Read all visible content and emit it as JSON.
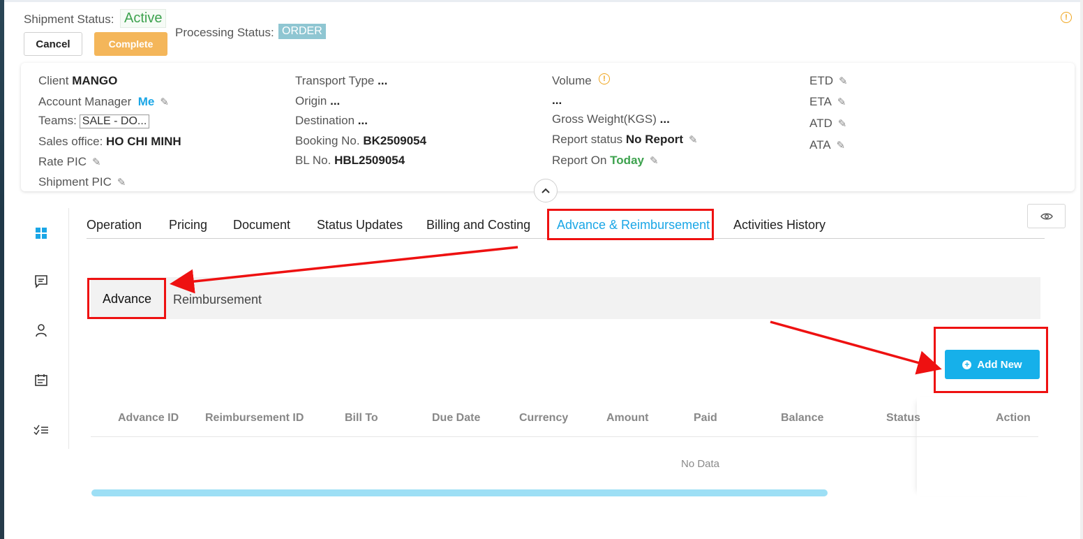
{
  "header": {
    "shipment_status_label": "Shipment Status:",
    "shipment_status_value": "Active",
    "processing_status_label": "Processing Status:",
    "processing_status_value": "ORDER",
    "cancel_label": "Cancel",
    "complete_label": "Complete"
  },
  "info": {
    "client_label": "Client",
    "client_value": "MANGO",
    "account_manager_label": "Account Manager",
    "account_manager_value": "Me",
    "teams_label": "Teams:",
    "teams_value": "SALE - DO...",
    "sales_office_label": "Sales office:",
    "sales_office_value": "HO CHI MINH",
    "rate_pic_label": "Rate PIC",
    "shipment_pic_label": "Shipment PIC",
    "transport_type_label": "Transport Type",
    "transport_type_value": "...",
    "origin_label": "Origin",
    "origin_value": "...",
    "destination_label": "Destination",
    "destination_value": "...",
    "booking_no_label": "Booking No.",
    "booking_no_value": "BK2509054",
    "bl_no_label": "BL No.",
    "bl_no_value": "HBL2509054",
    "volume_label": "Volume",
    "volume_value": "...",
    "gross_weight_label": "Gross Weight(KGS)",
    "gross_weight_value": "...",
    "report_status_label": "Report status",
    "report_status_value": "No Report",
    "report_on_label": "Report On",
    "report_on_value": "Today",
    "etd_label": "ETD",
    "eta_label": "ETA",
    "atd_label": "ATD",
    "ata_label": "ATA"
  },
  "tabs": [
    {
      "label": "Operation"
    },
    {
      "label": "Pricing"
    },
    {
      "label": "Document"
    },
    {
      "label": "Status Updates"
    },
    {
      "label": "Billing and Costing"
    },
    {
      "label": "Advance & Reimbursement"
    },
    {
      "label": "Activities History"
    }
  ],
  "subtabs": {
    "advance": "Advance",
    "reimbursement": "Reimbursement"
  },
  "add_new_label": "Add New",
  "table": {
    "columns": [
      "Advance ID",
      "Reimbursement ID",
      "Bill To",
      "Due Date",
      "Currency",
      "Amount",
      "Paid",
      "Balance",
      "Status",
      "Action"
    ],
    "empty_text": "No Data"
  },
  "colors": {
    "accent": "#1aa6e6",
    "active_green": "#3da24e",
    "complete_orange": "#f4b65a",
    "annotation_red": "#ee1111"
  }
}
